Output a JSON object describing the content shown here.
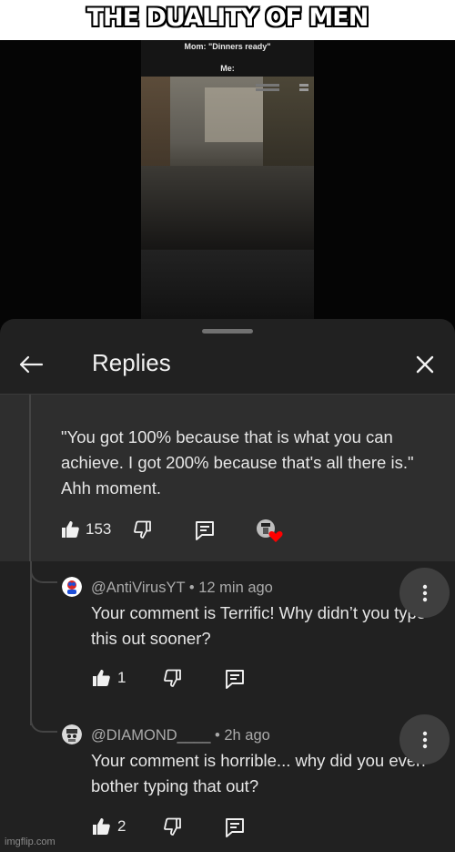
{
  "meme": {
    "title": "THE DUALITY OF MEN",
    "caption_top": "Mom: \"Dinners ready\"",
    "caption_me": "Me:",
    "watermark": "imgflip.com"
  },
  "panel": {
    "title": "Replies",
    "back_icon": "arrow-left-icon",
    "close_icon": "close-icon"
  },
  "parent_comment": {
    "text": "\"You got 100% because that is what you can achieve. I got 200% because that's all there is.\" Ahh moment.",
    "likes": "153"
  },
  "replies": [
    {
      "author": "@AntiVirusYT",
      "time": "• 12 min ago",
      "text": "Your comment is Terrific! Why didn’t you type this out sooner?",
      "likes": "1"
    },
    {
      "author": "@DIAMOND____",
      "time": "• 2h ago",
      "text": "Your comment is horrible... why did you even bother typing that out?",
      "likes": "2"
    }
  ],
  "colors": {
    "sheet_bg": "#212121",
    "highlight_bg": "#2e2e2e",
    "heart": "#ff0000",
    "secondary_text": "#aaaaaa"
  }
}
